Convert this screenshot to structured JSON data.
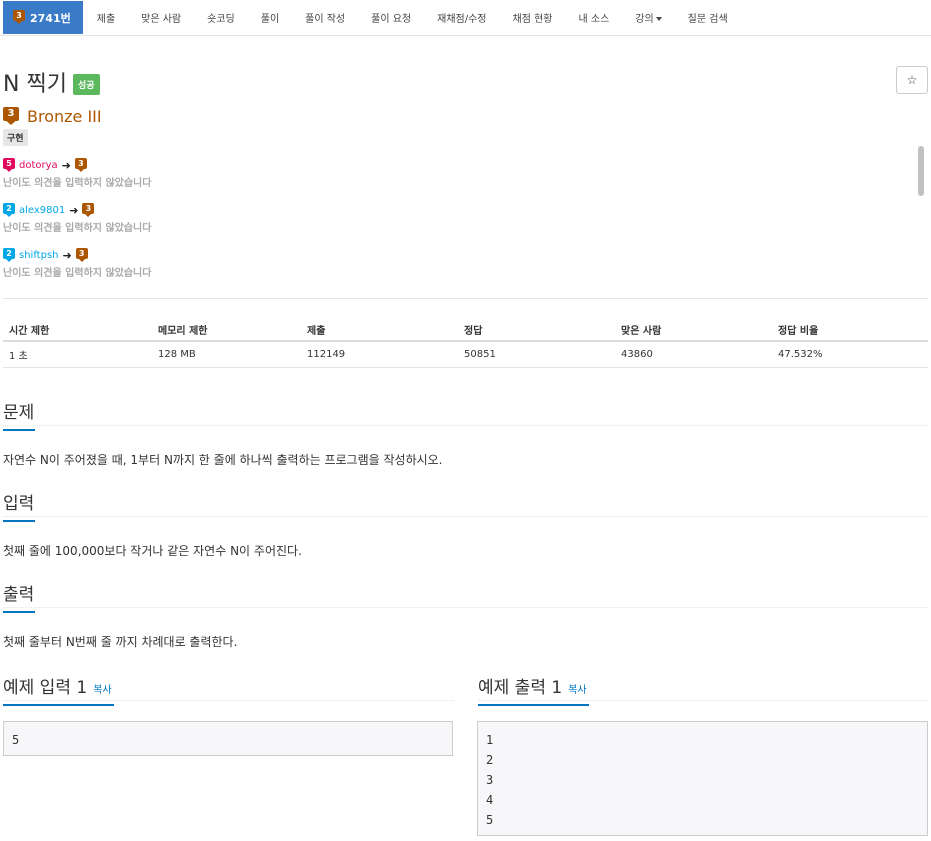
{
  "nav": {
    "problem_tier": "3",
    "problem_id": "2741번",
    "items": [
      "제출",
      "맞은 사람",
      "숏코딩",
      "풀이",
      "풀이 작성",
      "풀이 요청",
      "재채점/수정",
      "채점 현황",
      "내 소스",
      "강의",
      "질문 검색"
    ]
  },
  "problem": {
    "title": "N 찍기",
    "status_badge": "성공",
    "star": "☆",
    "tier_num": "3",
    "tier_name": "Bronze III",
    "tag": "구현"
  },
  "opinions": [
    {
      "user_tier": "5",
      "user": "dotorya",
      "user_color": "#e0095e",
      "vote_tier": "3",
      "text": "난이도 의견을 입력하지 않았습니다"
    },
    {
      "user_tier": "2",
      "user": "alex9801",
      "user_color": "#00a7e6",
      "vote_tier": "3",
      "text": "난이도 의견을 입력하지 않았습니다"
    },
    {
      "user_tier": "2",
      "user": "shiftpsh",
      "user_color": "#00a7e6",
      "vote_tier": "3",
      "text": "난이도 의견을 입력하지 않았습니다"
    }
  ],
  "stats": {
    "headers": [
      "시간 제한",
      "메모리 제한",
      "제출",
      "정답",
      "맞은 사람",
      "정답 비율"
    ],
    "values": [
      "1 초",
      "128 MB",
      "112149",
      "50851",
      "43860",
      "47.532%"
    ]
  },
  "sections": {
    "problem_heading": "문제",
    "problem_text": "자연수 N이 주어졌을 때, 1부터 N까지 한 줄에 하나씩 출력하는 프로그램을 작성하시오.",
    "input_heading": "입력",
    "input_text": "첫째 줄에 100,000보다 작거나 같은 자연수 N이 주어진다.",
    "output_heading": "출력",
    "output_text": "첫째 줄부터 N번째 줄 까지 차례대로 출력한다.",
    "sample_input_heading": "예제 입력 1",
    "sample_output_heading": "예제 출력 1",
    "copy_label": "복사",
    "sample_input": "5",
    "sample_output": "1\n2\n3\n4\n5"
  },
  "colors": {
    "accent": "#0076c0",
    "nav_active": "#3a7bc8",
    "bronze": "#ad5600",
    "success": "#5cb85c"
  }
}
